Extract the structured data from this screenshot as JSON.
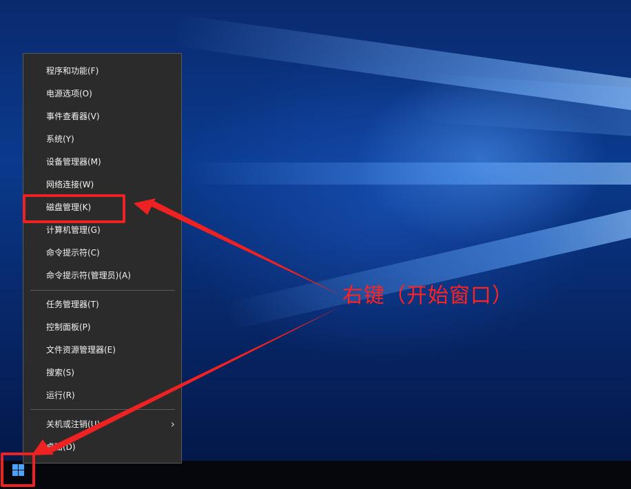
{
  "context_menu": {
    "group1": [
      {
        "label": "程序和功能(F)"
      },
      {
        "label": "电源选项(O)"
      },
      {
        "label": "事件查看器(V)"
      },
      {
        "label": "系统(Y)"
      },
      {
        "label": "设备管理器(M)"
      },
      {
        "label": "网络连接(W)"
      },
      {
        "label": "磁盘管理(K)"
      },
      {
        "label": "计算机管理(G)"
      },
      {
        "label": "命令提示符(C)"
      },
      {
        "label": "命令提示符(管理员)(A)"
      }
    ],
    "group2": [
      {
        "label": "任务管理器(T)"
      },
      {
        "label": "控制面板(P)"
      },
      {
        "label": "文件资源管理器(E)"
      },
      {
        "label": "搜索(S)"
      },
      {
        "label": "运行(R)"
      }
    ],
    "group3": [
      {
        "label": "关机或注销(U)",
        "submenu_icon": "chevron-right-icon"
      },
      {
        "label": "桌面(D)"
      }
    ]
  },
  "annotation": {
    "text": "右键（开始窗口）",
    "color": "#ff2222"
  },
  "taskbar": {
    "start_icon": "windows-logo-icon",
    "start_icon_color": "#4aa3ff"
  },
  "colors": {
    "menu_background": "#2b2b2b",
    "menu_text": "#f2f2f2",
    "highlight": "#ee2222",
    "desktop": "#0a3a8e"
  }
}
